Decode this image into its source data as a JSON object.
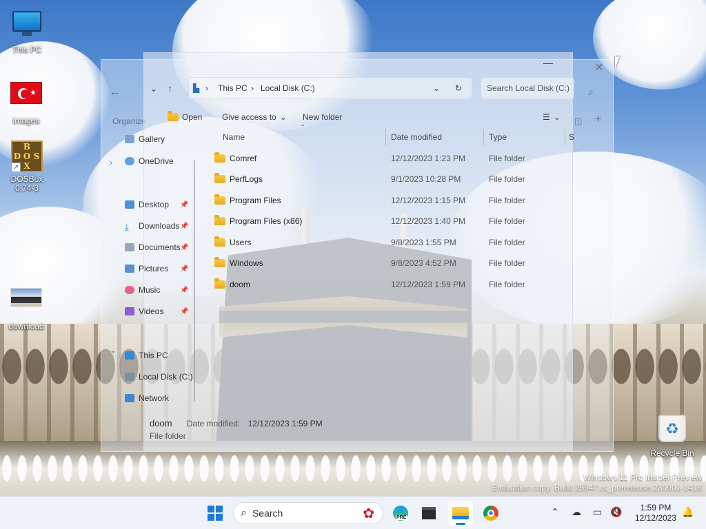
{
  "desktop": {
    "icons": [
      {
        "label": "This PC",
        "icon": "this-pc-icon"
      },
      {
        "label": "images",
        "icon": "turkey-flag-icon"
      },
      {
        "label": "DOSBox 0.74-3",
        "icon": "dosbox-icon",
        "letters": [
          "B",
          "D",
          "O",
          "S",
          "X"
        ]
      },
      {
        "label": "download",
        "icon": "image-file-icon"
      },
      {
        "label": "Recycle Bin",
        "icon": "recycle-bin-icon"
      }
    ],
    "watermark": {
      "line1": "Windows 11 Pro Insider Preview",
      "line2": "Evaluation copy. Build 25947.rs_prerelease.230901-1418"
    }
  },
  "ghost_window": {
    "organize": "Organize",
    "close": "×",
    "sidebar_fragments": [
      "Gallery",
      "OneDrive"
    ]
  },
  "explorer": {
    "minimize": "—",
    "address": {
      "root": "This PC",
      "current": "Local Disk (C:)",
      "separator": "›"
    },
    "search_placeholder": "Search Local Disk (C:)",
    "toolbar": {
      "open": "Open",
      "give_access": "Give access to",
      "new_folder": "New folder"
    },
    "columns": {
      "name": "Name",
      "date": "Date modified",
      "type": "Type",
      "size": "S"
    },
    "sidebar": {
      "gallery": "Gallery",
      "onedrive": "OneDrive",
      "desktop": "Desktop",
      "downloads": "Downloads",
      "documents": "Documents",
      "pictures": "Pictures",
      "music": "Music",
      "videos": "Videos",
      "this_pc": "This PC",
      "local_disk": "Local Disk (C:)",
      "network": "Network"
    },
    "rows": [
      {
        "name": "Comref",
        "date": "12/12/2023 1:23 PM",
        "type": "File folder"
      },
      {
        "name": "PerfLogs",
        "date": "9/1/2023 10:28 PM",
        "type": "File folder"
      },
      {
        "name": "Program Files",
        "date": "12/12/2023 1:15 PM",
        "type": "File folder"
      },
      {
        "name": "Program Files (x86)",
        "date": "12/12/2023 1:40 PM",
        "type": "File folder"
      },
      {
        "name": "Users",
        "date": "9/8/2023 1:55 PM",
        "type": "File folder"
      },
      {
        "name": "Windows",
        "date": "9/8/2023 4:52 PM",
        "type": "File folder"
      },
      {
        "name": "doom",
        "date": "12/12/2023 1:59 PM",
        "type": "File folder"
      }
    ],
    "status": {
      "name": "doom",
      "date_label": "Date modified:",
      "date_value": "12/12/2023 1:59 PM",
      "kind": "File folder"
    }
  },
  "taskbar": {
    "search_label": "Search",
    "pinned": [
      "start-icon",
      "edge-dev-icon",
      "terminal-icon",
      "file-explorer-icon",
      "chrome-icon"
    ],
    "edge_badge": "PRE",
    "time": "1:59 PM",
    "date": "12/12/2023"
  },
  "colors": {
    "accent": "#1f7ad6",
    "folder": "#e8ad1c",
    "taskbar": "#eef1f6"
  }
}
